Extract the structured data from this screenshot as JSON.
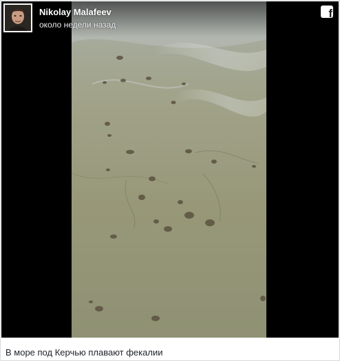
{
  "post": {
    "author": "Nikolay Malafeev",
    "time": "около недели назад",
    "platform_icon": "facebook-icon"
  },
  "video": {
    "scene": "sea-water-surface"
  },
  "caption": "В море под Керчью плавают фекалии",
  "colors": {
    "letterbox": "#000000",
    "water": "#9a9a7c",
    "caption_text": "#1d2129"
  }
}
